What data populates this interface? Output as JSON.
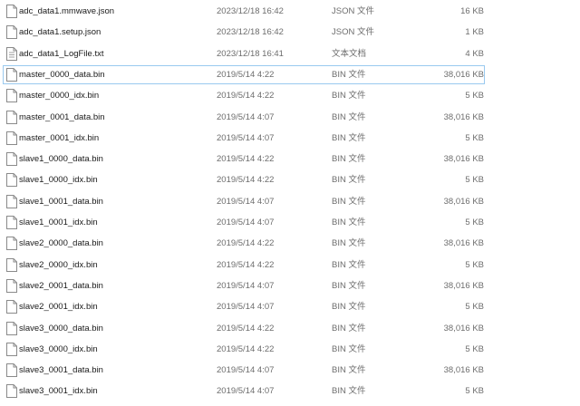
{
  "files": [
    {
      "name": "adc_data1.mmwave.json",
      "modified": "2023/12/18 16:42",
      "type": "JSON 文件",
      "size": "16 KB",
      "icon": "json-file-icon"
    },
    {
      "name": "adc_data1.setup.json",
      "modified": "2023/12/18 16:42",
      "type": "JSON 文件",
      "size": "1 KB",
      "icon": "json-file-icon"
    },
    {
      "name": "adc_data1_LogFile.txt",
      "modified": "2023/12/18 16:41",
      "type": "文本文档",
      "size": "4 KB",
      "icon": "text-file-icon"
    },
    {
      "name": "master_0000_data.bin",
      "modified": "2019/5/14 4:22",
      "type": "BIN 文件",
      "size": "38,016 KB",
      "icon": "bin-file-icon",
      "selected": true
    },
    {
      "name": "master_0000_idx.bin",
      "modified": "2019/5/14 4:22",
      "type": "BIN 文件",
      "size": "5 KB",
      "icon": "bin-file-icon"
    },
    {
      "name": "master_0001_data.bin",
      "modified": "2019/5/14 4:07",
      "type": "BIN 文件",
      "size": "38,016 KB",
      "icon": "bin-file-icon"
    },
    {
      "name": "master_0001_idx.bin",
      "modified": "2019/5/14 4:07",
      "type": "BIN 文件",
      "size": "5 KB",
      "icon": "bin-file-icon"
    },
    {
      "name": "slave1_0000_data.bin",
      "modified": "2019/5/14 4:22",
      "type": "BIN 文件",
      "size": "38,016 KB",
      "icon": "bin-file-icon"
    },
    {
      "name": "slave1_0000_idx.bin",
      "modified": "2019/5/14 4:22",
      "type": "BIN 文件",
      "size": "5 KB",
      "icon": "bin-file-icon"
    },
    {
      "name": "slave1_0001_data.bin",
      "modified": "2019/5/14 4:07",
      "type": "BIN 文件",
      "size": "38,016 KB",
      "icon": "bin-file-icon"
    },
    {
      "name": "slave1_0001_idx.bin",
      "modified": "2019/5/14 4:07",
      "type": "BIN 文件",
      "size": "5 KB",
      "icon": "bin-file-icon"
    },
    {
      "name": "slave2_0000_data.bin",
      "modified": "2019/5/14 4:22",
      "type": "BIN 文件",
      "size": "38,016 KB",
      "icon": "bin-file-icon"
    },
    {
      "name": "slave2_0000_idx.bin",
      "modified": "2019/5/14 4:22",
      "type": "BIN 文件",
      "size": "5 KB",
      "icon": "bin-file-icon"
    },
    {
      "name": "slave2_0001_data.bin",
      "modified": "2019/5/14 4:07",
      "type": "BIN 文件",
      "size": "38,016 KB",
      "icon": "bin-file-icon"
    },
    {
      "name": "slave2_0001_idx.bin",
      "modified": "2019/5/14 4:07",
      "type": "BIN 文件",
      "size": "5 KB",
      "icon": "bin-file-icon"
    },
    {
      "name": "slave3_0000_data.bin",
      "modified": "2019/5/14 4:22",
      "type": "BIN 文件",
      "size": "38,016 KB",
      "icon": "bin-file-icon"
    },
    {
      "name": "slave3_0000_idx.bin",
      "modified": "2019/5/14 4:22",
      "type": "BIN 文件",
      "size": "5 KB",
      "icon": "bin-file-icon"
    },
    {
      "name": "slave3_0001_data.bin",
      "modified": "2019/5/14 4:07",
      "type": "BIN 文件",
      "size": "38,016 KB",
      "icon": "bin-file-icon"
    },
    {
      "name": "slave3_0001_idx.bin",
      "modified": "2019/5/14 4:07",
      "type": "BIN 文件",
      "size": "5 KB",
      "icon": "bin-file-icon"
    }
  ]
}
